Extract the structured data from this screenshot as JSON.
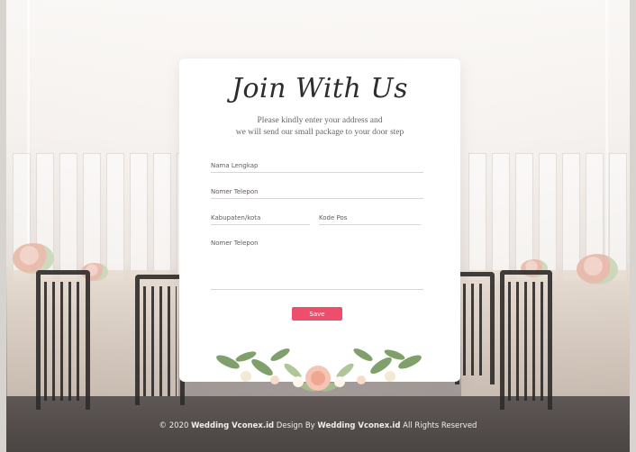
{
  "card": {
    "title": "Join With Us",
    "subtitle_line1": "Please kindly enter your address and",
    "subtitle_line2": "we will send our small package to your door step"
  },
  "form": {
    "name_placeholder": "Nama Lengkap",
    "phone_placeholder": "Nomer Telepon",
    "city_placeholder": "Kabupaten/kota",
    "postal_placeholder": "Kode Pos",
    "address_placeholder": "Nomer Telepon",
    "save_label": "Save"
  },
  "footer": {
    "prefix": "© 2020",
    "brand1": "Wedding Vconex.id",
    "middle": "Design By",
    "brand2": "Wedding Vconex.id",
    "suffix": "All Rights Reserved"
  },
  "colors": {
    "accent": "#ee4d6c",
    "card_bg": "#ffffff",
    "text_dark": "#2f2c2c"
  }
}
